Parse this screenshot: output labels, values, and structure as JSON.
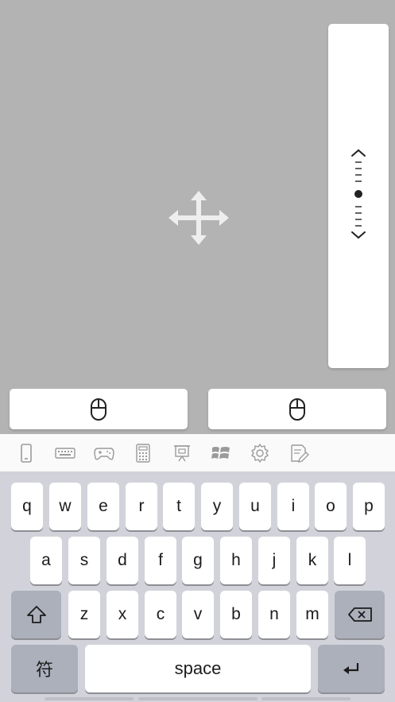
{
  "touchpad": {
    "move_icon": "move-arrows-icon",
    "scroll_icon": "vertical-scroll-icon",
    "left_click_icon": "mouse-left-icon",
    "right_click_icon": "mouse-right-icon"
  },
  "toolbar": {
    "icons": [
      "phone-icon",
      "keyboard-icon",
      "gamepad-icon",
      "calculator-icon",
      "presentation-icon",
      "windows-icon",
      "settings-icon",
      "notes-icon"
    ]
  },
  "keyboard": {
    "row1": [
      "q",
      "w",
      "e",
      "r",
      "t",
      "y",
      "u",
      "i",
      "o",
      "p"
    ],
    "row2": [
      "a",
      "s",
      "d",
      "f",
      "g",
      "h",
      "j",
      "k",
      "l"
    ],
    "row3": [
      "z",
      "x",
      "c",
      "v",
      "b",
      "n",
      "m"
    ],
    "shift_icon": "shift-icon",
    "backspace_icon": "backspace-icon",
    "symbols_label": "符",
    "space_label": "space",
    "return_icon": "return-icon"
  },
  "colors": {
    "touchpad_bg": "#b3b3b3",
    "keyboard_bg": "#d2d3da",
    "dark_key": "#abb0bb",
    "icon_gray": "#9a9a9a"
  }
}
